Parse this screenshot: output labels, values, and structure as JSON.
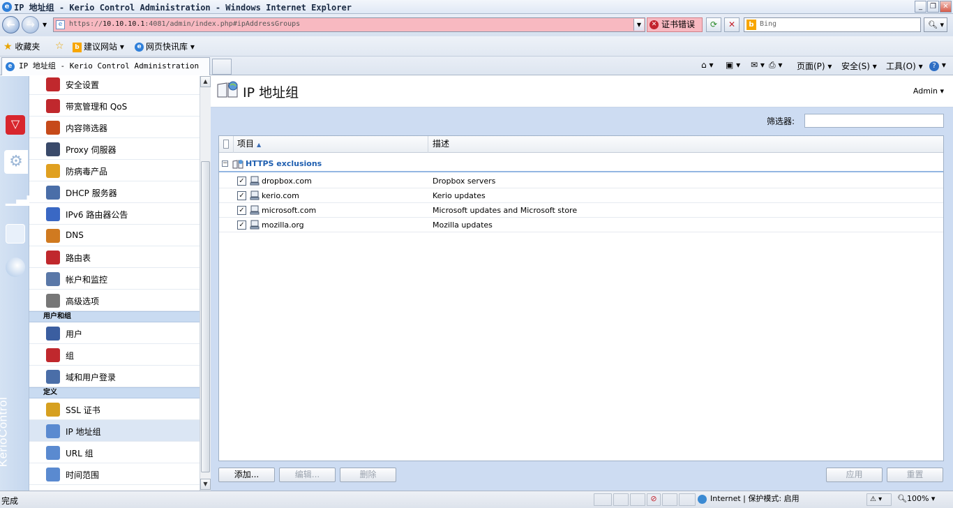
{
  "window": {
    "title": "IP 地址组 - Kerio Control Administration - Windows Internet Explorer",
    "minimize": "_",
    "maximize": "❐",
    "close": "✕"
  },
  "browser": {
    "url_prefix": "https://",
    "url_host": "10.10.10.1",
    "url_rest": ":4081/admin/index.php#ipAddressGroups",
    "cert_error": "证书错误",
    "search_placeholder": "Bing",
    "favorites": "收藏夹",
    "suggested_sites": "建议网站 ▾",
    "web_slice": "网页快讯库 ▾",
    "tab_title": "IP 地址组 - Kerio Control Administration",
    "toolbar": {
      "page": "页面(P) ▾",
      "safety": "安全(S) ▾",
      "tools": "工具(O) ▾"
    }
  },
  "sidebar": {
    "brand": "KerioControl",
    "items": [
      {
        "label": "安全设置",
        "icon": "shield-icon",
        "color": "#c0282d"
      },
      {
        "label": "带宽管理和 QoS",
        "icon": "bandwidth-icon",
        "color": "#c0282d"
      },
      {
        "label": "内容筛选器",
        "icon": "filter-icon",
        "color": "#c64a1a"
      },
      {
        "label": "Proxy 伺服器",
        "icon": "proxy-icon",
        "color": "#3a4a6a"
      },
      {
        "label": "防病毒产品",
        "icon": "antivirus-icon",
        "color": "#e0a020"
      },
      {
        "label": "DHCP 服务器",
        "icon": "dhcp-icon",
        "color": "#4a6ea8"
      },
      {
        "label": "IPv6 路由器公告",
        "icon": "ipv6-icon",
        "color": "#3a68c4"
      },
      {
        "label": "DNS",
        "icon": "dns-icon",
        "color": "#d07a20"
      },
      {
        "label": "路由表",
        "icon": "routing-icon",
        "color": "#c0282d"
      },
      {
        "label": "帐户和监控",
        "icon": "accounting-icon",
        "color": "#5a78a8"
      },
      {
        "label": "高级选项",
        "icon": "advanced-icon",
        "color": "#777777"
      }
    ],
    "section_users": "用户和组",
    "users_items": [
      {
        "label": "用户",
        "icon": "user-icon",
        "color": "#3b5ea0"
      },
      {
        "label": "组",
        "icon": "group-icon",
        "color": "#c0282d"
      },
      {
        "label": "域和用户登录",
        "icon": "domain-icon",
        "color": "#4a6ea8"
      }
    ],
    "section_definitions": "定义",
    "def_items": [
      {
        "label": "SSL 证书",
        "icon": "certificate-icon",
        "color": "#d6a020"
      },
      {
        "label": "IP 地址组",
        "icon": "ip-group-icon",
        "color": "#5a8ad0"
      },
      {
        "label": "URL 组",
        "icon": "url-group-icon",
        "color": "#5a8ad0"
      },
      {
        "label": "时间范围",
        "icon": "time-range-icon",
        "color": "#5a8ad0"
      }
    ]
  },
  "main": {
    "title": "IP 地址组",
    "admin": "Admin ▾",
    "filter_label": "筛选器:",
    "columns": {
      "item": "项目",
      "description": "描述"
    },
    "group_name": "HTTPS exclusions",
    "rows": [
      {
        "name": "dropbox.com",
        "description": "Dropbox servers"
      },
      {
        "name": "kerio.com",
        "description": "Kerio updates"
      },
      {
        "name": "microsoft.com",
        "description": "Microsoft updates and Microsoft store"
      },
      {
        "name": "mozilla.org",
        "description": "Mozilla updates"
      }
    ],
    "buttons": {
      "add": "添加...",
      "edit": "编辑...",
      "delete": "删除",
      "apply": "应用",
      "reset": "重置"
    }
  },
  "status": {
    "text": "完成",
    "zone": "Internet | 保护模式: 启用",
    "zoom": "100% ▾"
  },
  "colors": {
    "accent": "#1f5fb0",
    "cert_error_bg": "#f8b9c1",
    "panel_bg": "#cddcf2"
  }
}
